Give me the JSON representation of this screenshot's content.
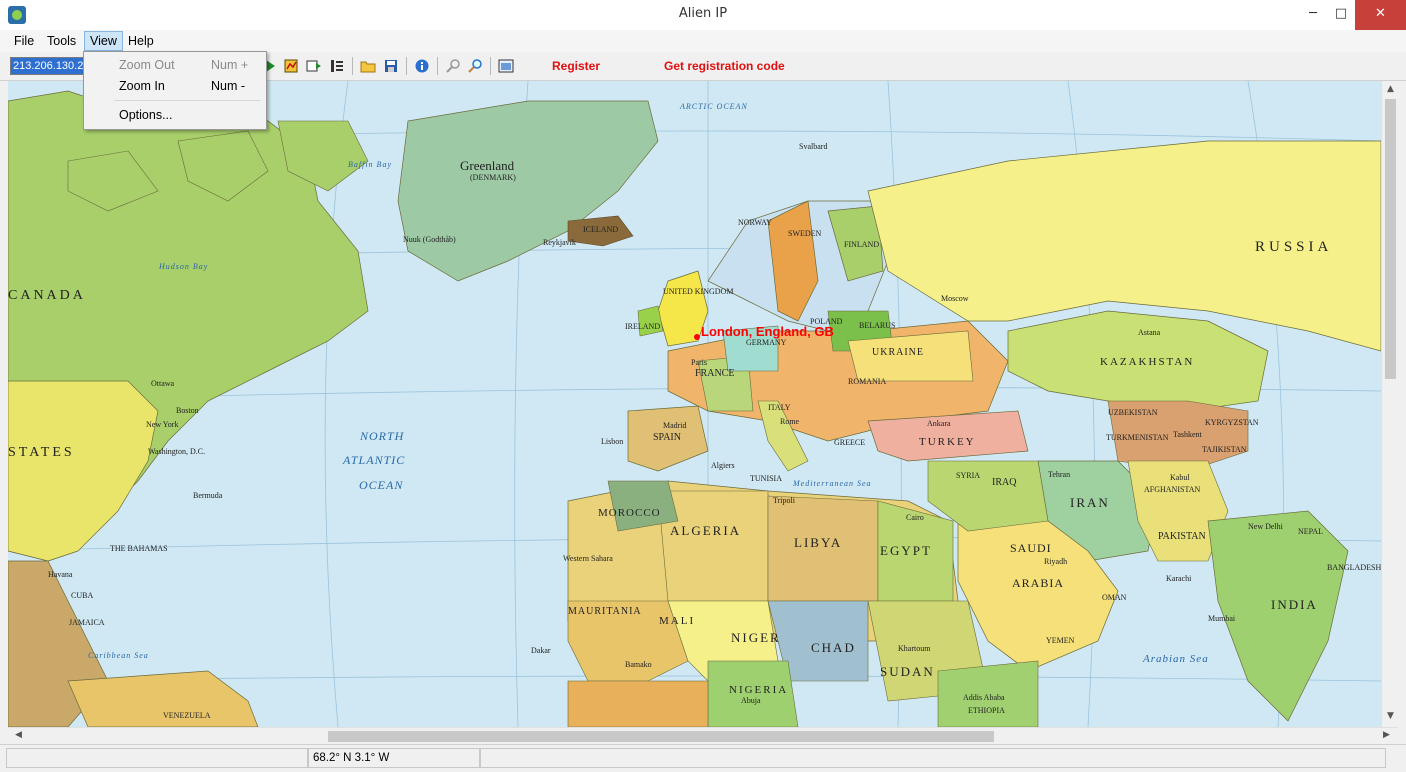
{
  "window": {
    "title": "Alien IP",
    "min": "─",
    "max": "□",
    "close": "✕"
  },
  "menu": {
    "file": "File",
    "tools": "Tools",
    "view": "View",
    "help": "Help"
  },
  "view_menu": {
    "items": [
      {
        "label": "Zoom Out",
        "shortcut": "Num +",
        "enabled": false
      },
      {
        "label": "Zoom In",
        "shortcut": "Num -",
        "enabled": true
      },
      {
        "label": "Options...",
        "shortcut": "",
        "enabled": true
      }
    ]
  },
  "toolbar": {
    "ip_value": "213.206.130.2",
    "register": "Register",
    "get_code": "Get registration code"
  },
  "map": {
    "marker_text": "London, England, GB",
    "labels": {
      "russia": "RUSSIA",
      "canada": "CANADA",
      "states": "STATES",
      "greenland": "Greenland",
      "denmark": "(DENMARK)",
      "kazakhstan": "KAZAKHSTAN",
      "north": "NORTH",
      "atlantic": "ATLANTIC",
      "ocean": "OCEAN",
      "algeria": "ALGERIA",
      "libya": "LIBYA",
      "egypt": "EGYPT",
      "mali": "MALI",
      "niger": "NIGER",
      "chad": "CHAD",
      "sudan": "SUDAN",
      "nigeria": "NIGERIA",
      "mauritania": "MAURITANIA",
      "morocco": "MOROCCO",
      "saudi": "SAUDI",
      "arabia": "ARABIA",
      "iran": "IRAN",
      "india": "INDIA",
      "pakistan": "PAKISTAN",
      "afghanistan": "AFGHANISTAN",
      "turkey": "TURKEY",
      "ukraine": "UKRAINE",
      "france": "FRANCE",
      "spain": "SPAIN",
      "iceland": "ICELAND",
      "sweden": "SWEDEN",
      "finland": "FINLAND",
      "norway": "NORWAY",
      "poland": "POLAND",
      "germany": "GERMANY",
      "italy": "ITALY",
      "iraq": "IRAQ",
      "syria": "SYRIA",
      "yemen": "YEMEN",
      "oman": "OMAN",
      "ethiopia": "ETHIOPIA",
      "venezuela": "VENEZUELA",
      "arctic": "ARCTIC OCEAN",
      "hudson": "Hudson Bay",
      "baffin": "Baffin Bay",
      "arabian": "Arabian Sea",
      "med": "Mediterranean Sea",
      "caribbean": "Caribbean Sea",
      "reykjavik": "Reykjavik",
      "moscow": "Moscow",
      "tehran": "Tehran",
      "cairo": "Cairo",
      "ottawa": "Ottawa",
      "washington": "Washington, D.C.",
      "bermuda": "Bermuda",
      "havana": "Havana",
      "western_sahara": "Western Sahara",
      "belarus": "BELARUS",
      "romania": "ROMANIA",
      "new_york": "New York",
      "boston": "Boston",
      "nuuk": "Nuuk (Godthåb)",
      "svalbard": "Svalbard",
      "kabul": "Kabul",
      "new_delhi": "New Delhi",
      "karachi": "Karachi",
      "mumbai": "Mumbai",
      "riyadh": "Riyadh",
      "ankara": "Ankara",
      "madrid": "Madrid",
      "paris": "Paris",
      "rome": "Rome",
      "algiers": "Algiers",
      "tripoli": "Tripoli",
      "khartoum": "Khartoum",
      "addis": "Addis Ababa",
      "tashkent": "Tashkent",
      "astana": "Astana",
      "abuja": "Abuja",
      "bamako": "Bamako",
      "dakar": "Dakar",
      "nepal": "NEPAL",
      "lisbon": "Lisbon",
      "ireland": "IRELAND",
      "united_kingdom": "UNITED KINGDOM",
      "turkmenistan": "TURKMENISTAN",
      "uzbekistan": "UZBEKISTAN",
      "kyrgyzstan": "KYRGYZSTAN",
      "tajikistan": "TAJIKISTAN",
      "bangladesh": "BANGLADESH",
      "tunisia": "TUNISIA",
      "greece": "GREECE",
      "cuba": "CUBA",
      "the_bahamas": "THE BAHAMAS",
      "jamaica": "JAMAICA"
    }
  },
  "status": {
    "coords": "68.2° N 3.1° W"
  },
  "colors": {
    "sea": "#cfe8f3",
    "marker": "#ff0000",
    "link": "#e01010"
  }
}
